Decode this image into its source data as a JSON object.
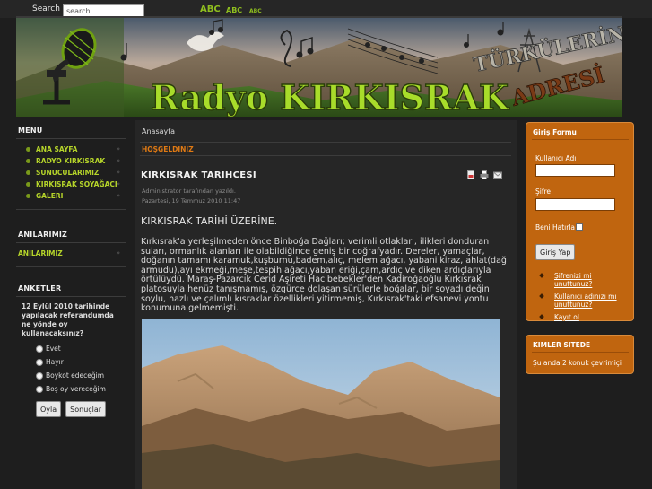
{
  "topbar": {
    "search_label": "Search",
    "search_value": "search...",
    "font_size_large": "ABC",
    "font_size_medium": "ABC",
    "font_size_small": "ABC"
  },
  "banner": {
    "site_name": "Radyo KIRKISRAK",
    "tagline_1": "TÜRKÜLERİN",
    "tagline_2": "ADRESİ"
  },
  "menu": {
    "title": "MENU",
    "items": [
      {
        "label": "ANA SAYFA"
      },
      {
        "label": "RADYO KIRKISRAK"
      },
      {
        "label": "SUNUCULARIMIZ"
      },
      {
        "label": "KIRKISRAK SOYAĞACI"
      },
      {
        "label": "GALERI"
      }
    ]
  },
  "memories": {
    "title": "ANILARIMIZ",
    "items": [
      {
        "label": "ANILARIMIZ"
      }
    ]
  },
  "poll": {
    "title": "ANKETLER",
    "question": "12 Eylül 2010 tarihinde yapılacak referandumda ne yönde oy kullanacaksınız?",
    "options": [
      "Evet",
      "Hayır",
      "Boykot edeceğim",
      "Boş oy vereceğim"
    ],
    "vote_button": "Oyla",
    "results_button": "Sonuçlar"
  },
  "content": {
    "breadcrumb": "Anasayfa",
    "welcome": "HOŞGELDINIZ",
    "article_title": "KIRKISRAK TARIHCESI",
    "author": "Administrator tarafından yazıldı.",
    "date": "Pazartesi, 19 Temmuz 2010 11:47",
    "heading": "KIRKISRAK TARİHİ ÜZERİNE.",
    "body": "Kırkısrak'a yerleşilmeden önce Binboğa Dağları; verimli otlakları, ilikleri donduran suları, ormanlık alanları ile olabildiğince geniş bir coğrafyadır. Dereler, yamaçlar, doğanın tamamı karamuk,kuşburnu,badem,alıç, melem ağacı, yabani kiraz, ahlat(dağ armudu),ayı ekmeği,meşe,tespih ağacı,yaban eriği,çam,ardıç ve diken ardıçlarıyla örtülüydü. Maraş-Pazarcık Cerid Aşireti Hacıbebekler'den Kadiroğaoğlu Kırkısrak platosuyla henüz tanışmamış, özgürce dolaşan sürülerle boğalar, bir soyadı değin soylu, nazlı ve çalımlı kısraklar özellikleri yitirmemiş, Kırkısrak'taki efsanevi yontu konumuna gelmemişti."
  },
  "login": {
    "title": "Giriş Formu",
    "username_label": "Kullanıcı Adı",
    "password_label": "Şifre",
    "remember_label": "Beni Hatırla",
    "submit": "Giriş Yap",
    "links": [
      "Şifrenizi mi unuttunuz?",
      "Kullanıcı adınızı mı unuttunuz?",
      "Kayıt ol"
    ]
  },
  "online": {
    "title": "KIMLER SITEDE",
    "text": "Şu anda 2 konuk çevrimiçi"
  },
  "colors": {
    "accent_green": "#b6d52a",
    "accent_orange": "#c0650f",
    "welcome_orange": "#e07a14",
    "background": "#1e1e1e"
  }
}
